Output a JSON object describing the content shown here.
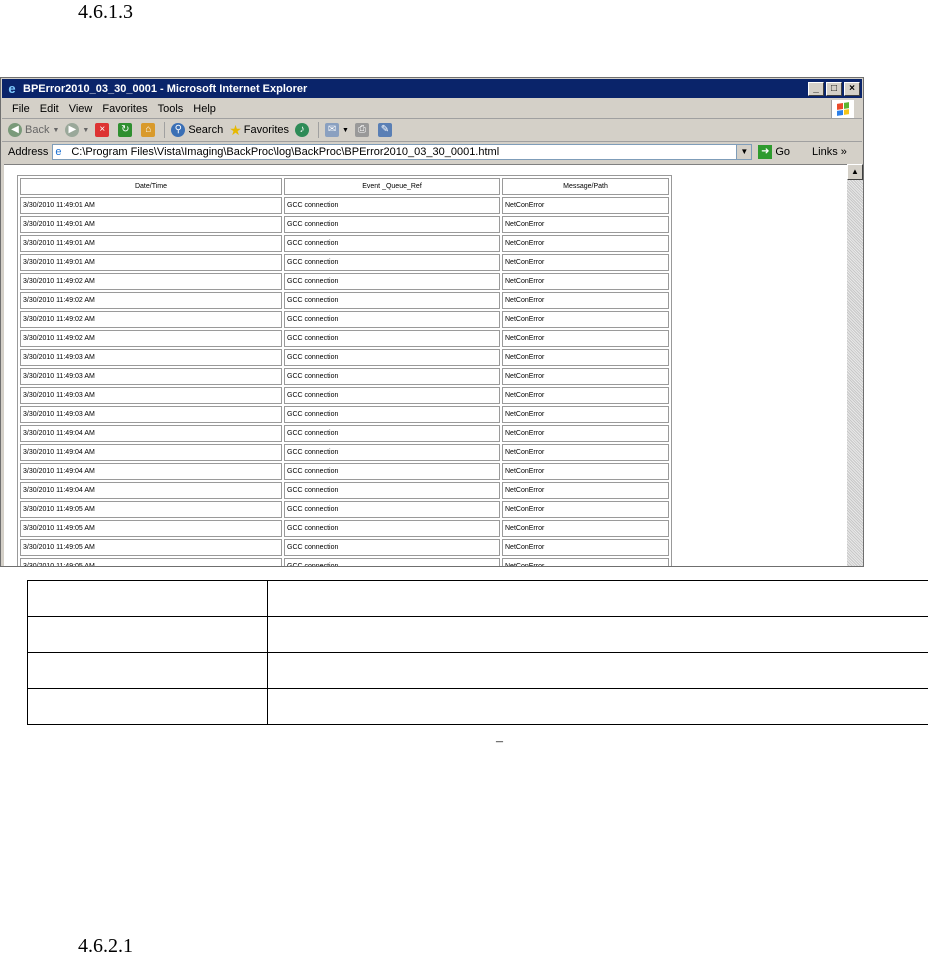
{
  "headings": [
    "4.6.1.3",
    "4.6.2.1"
  ],
  "dash": "–",
  "window": {
    "title": "BPError2010_03_30_0001 - Microsoft Internet Explorer",
    "controls": [
      "_",
      "□",
      "×"
    ],
    "menu": [
      "File",
      "Edit",
      "View",
      "Favorites",
      "Tools",
      "Help"
    ],
    "toolbar": {
      "back": "Back",
      "search": "Search",
      "favorites": "Favorites"
    },
    "address_label": "Address",
    "address": "C:\\Program Files\\Vista\\Imaging\\BackProc\\log\\BackProc\\BPError2010_03_30_0001.html",
    "go": "Go",
    "links": "Links"
  },
  "log_table": {
    "headers": [
      "Date/Time",
      "Event _Queue_Ref",
      "Message/Path"
    ],
    "rows": [
      [
        "3/30/2010 11:49:01 AM",
        "GCC connection",
        "NetConError"
      ],
      [
        "3/30/2010 11:49:01 AM",
        "GCC connection",
        "NetConError"
      ],
      [
        "3/30/2010 11:49:01 AM",
        "GCC connection",
        "NetConError"
      ],
      [
        "3/30/2010 11:49:01 AM",
        "GCC connection",
        "NetConError"
      ],
      [
        "3/30/2010 11:49:02 AM",
        "GCC connection",
        "NetConError"
      ],
      [
        "3/30/2010 11:49:02 AM",
        "GCC connection",
        "NetConError"
      ],
      [
        "3/30/2010 11:49:02 AM",
        "GCC connection",
        "NetConError"
      ],
      [
        "3/30/2010 11:49:02 AM",
        "GCC connection",
        "NetConError"
      ],
      [
        "3/30/2010 11:49:03 AM",
        "GCC connection",
        "NetConError"
      ],
      [
        "3/30/2010 11:49:03 AM",
        "GCC connection",
        "NetConError"
      ],
      [
        "3/30/2010 11:49:03 AM",
        "GCC connection",
        "NetConError"
      ],
      [
        "3/30/2010 11:49:03 AM",
        "GCC connection",
        "NetConError"
      ],
      [
        "3/30/2010 11:49:04 AM",
        "GCC connection",
        "NetConError"
      ],
      [
        "3/30/2010 11:49:04 AM",
        "GCC connection",
        "NetConError"
      ],
      [
        "3/30/2010 11:49:04 AM",
        "GCC connection",
        "NetConError"
      ],
      [
        "3/30/2010 11:49:04 AM",
        "GCC connection",
        "NetConError"
      ],
      [
        "3/30/2010 11:49:05 AM",
        "GCC connection",
        "NetConError"
      ],
      [
        "3/30/2010 11:49:05 AM",
        "GCC connection",
        "NetConError"
      ],
      [
        "3/30/2010 11:49:05 AM",
        "GCC connection",
        "NetConError"
      ],
      [
        "3/30/2010 11:49:05 AM",
        "GCC connection",
        "NetConError"
      ]
    ]
  },
  "info_table_rows": 4
}
